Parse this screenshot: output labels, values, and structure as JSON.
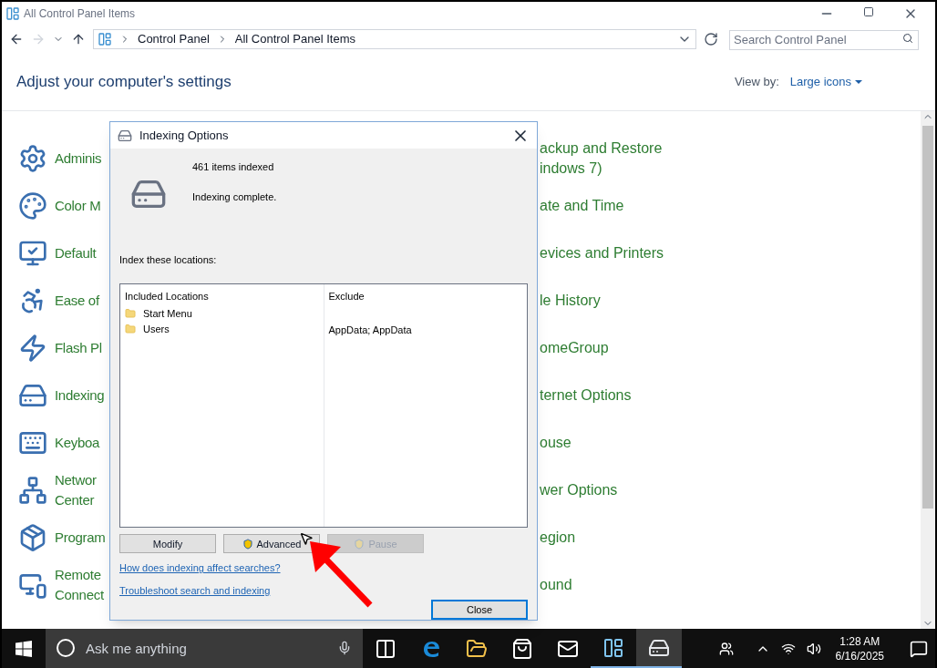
{
  "window": {
    "title": "All Control Panel Items"
  },
  "address_bar": {
    "path": [
      "Control Panel",
      "All Control Panel Items"
    ]
  },
  "search": {
    "placeholder": "Search Control Panel"
  },
  "heading": "Adjust your computer's settings",
  "view_by": {
    "label": "View by:",
    "value": "Large icons"
  },
  "items_left": [
    {
      "lines": [
        "Adminis"
      ]
    },
    {
      "lines": [
        "Color M"
      ]
    },
    {
      "lines": [
        "Default"
      ]
    },
    {
      "lines": [
        "Ease of"
      ]
    },
    {
      "lines": [
        "Flash Pl"
      ]
    },
    {
      "lines": [
        "Indexing"
      ]
    },
    {
      "lines": [
        "Keyboa"
      ]
    },
    {
      "lines": [
        "Networ",
        "Center"
      ]
    },
    {
      "lines": [
        "Program"
      ]
    },
    {
      "lines": [
        "Remote",
        "Connect"
      ]
    }
  ],
  "items_right": [
    {
      "lines": [
        "ackup and Restore",
        "indows 7)"
      ]
    },
    {
      "lines": [
        "ate and Time"
      ]
    },
    {
      "lines": [
        "evices and Printers"
      ]
    },
    {
      "lines": [
        "le History"
      ]
    },
    {
      "lines": [
        "omeGroup"
      ]
    },
    {
      "lines": [
        "ternet Options"
      ]
    },
    {
      "lines": [
        "ouse"
      ]
    },
    {
      "lines": [
        "wer Options"
      ]
    },
    {
      "lines": [
        "egion"
      ]
    },
    {
      "lines": [
        "ound"
      ]
    }
  ],
  "dialog": {
    "title": "Indexing Options",
    "count": "461 items indexed",
    "status": "Indexing complete.",
    "locations_label": "Index these locations:",
    "columns": [
      "Included Locations",
      "Exclude"
    ],
    "rows": [
      {
        "location": "Start Menu"
      },
      {
        "location": "Users",
        "exclude": "AppData; AppData"
      }
    ],
    "buttons": [
      {
        "label": "Modify",
        "shield": false,
        "disabled": false
      },
      {
        "label": "Advanced",
        "shield": true,
        "disabled": false
      },
      {
        "label": "Pause",
        "shield": true,
        "disabled": true
      }
    ],
    "links": [
      "How does indexing affect searches?",
      "Troubleshoot search and indexing"
    ],
    "close_button": {
      "label": "Close",
      "default": true
    }
  },
  "taskbar": {
    "search_placeholder": "Ask me anything",
    "time": "1:28 AM",
    "date": "6/16/2025",
    "apps": [
      {
        "selected": false
      },
      {
        "selected": false
      },
      {
        "selected": false
      },
      {
        "selected": false
      },
      {
        "selected": false
      },
      {
        "selected": true
      },
      {
        "selected": true
      }
    ]
  }
}
